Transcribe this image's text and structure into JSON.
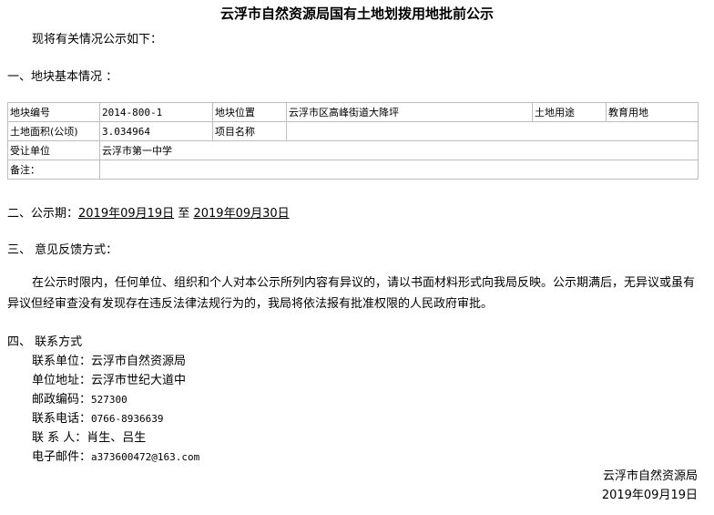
{
  "title": "云浮市自然资源局国有土地划拨用地批前公示",
  "intro": "现将有关情况公示如下：",
  "section1": {
    "heading": "一、地块基本情况 ："
  },
  "table": {
    "r1": [
      "地块编号",
      "2014-800-1",
      "地块位置",
      "云浮市区高峰街道大降坪",
      "土地用途",
      "教育用地"
    ],
    "r2": [
      "土地面积(公顷)",
      "3.034964",
      "项目名称",
      ""
    ],
    "r3": [
      "受让单位",
      "云浮市第一中学"
    ],
    "r4": [
      "备注：",
      ""
    ]
  },
  "section2": {
    "prefix": "二、公示期：",
    "start": "2019年09月19日",
    "mid": "至",
    "end": "2019年09月30日"
  },
  "section3": {
    "heading": "三、    意见反馈方式：",
    "body": "在公示时限内，任何单位、组织和个人对本公示所列内容有异议的，请以书面材料形式向我局反映。公示期满后，无异议或虽有异议但经审查没有发现存在违反法律法规行为的，我局将依法报有批准权限的人民政府审批。"
  },
  "section4": {
    "heading": "四、    联系方式",
    "unit": "联系单位：云浮市自然资源局",
    "address": "单位地址：云浮市世纪大道中",
    "postcode_label": "邮政编码：",
    "postcode": "527300",
    "phone_label": "联系电话：",
    "phone": "0766-8936639",
    "contact": "联 系 人：肖生、吕生",
    "email_label": "电子邮件：",
    "email": "a373600472@163.com"
  },
  "footer": {
    "org": "云浮市自然资源局",
    "date": "2019年09月19日"
  }
}
